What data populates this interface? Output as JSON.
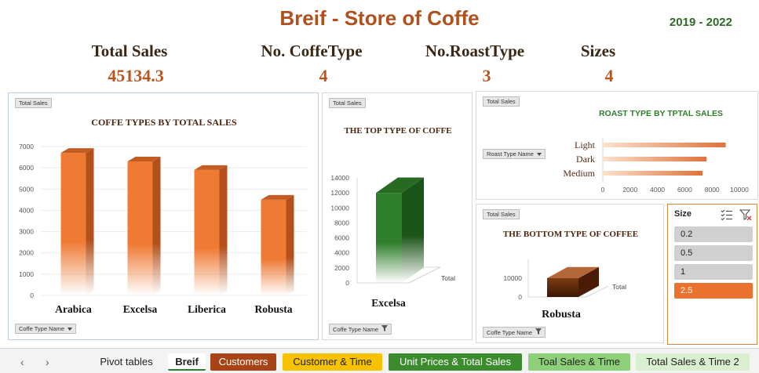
{
  "header": {
    "title": "Breif - Store of Coffe",
    "years": "2019 - 2022"
  },
  "kpis": [
    {
      "label": "Total Sales",
      "value": "45134.3"
    },
    {
      "label": "No. CoffeType",
      "value": "4"
    },
    {
      "label": "No.RoastType",
      "value": "3"
    },
    {
      "label": "Sizes",
      "value": "4"
    }
  ],
  "chips": {
    "total_sales": "Total Sales",
    "coffe_type_name": "Coffe Type Name",
    "roast_type_name": "Roast Type Name"
  },
  "colors": {
    "accent_orange": "#e8722e",
    "title_brown": "#b0501c",
    "green": "#2e6b25",
    "bar_green": "#2f7f2a",
    "bar_brown": "#6b3410"
  },
  "chart_data": [
    {
      "id": "coffe-types",
      "type": "bar",
      "title": "COFFE TYPES  BY  TOTAL SALES",
      "categories": [
        "Arabica",
        "Excelsa",
        "Liberica",
        "Robusta"
      ],
      "values": [
        6700,
        6300,
        5900,
        4500
      ],
      "yticks": [
        "0",
        "1000",
        "2000",
        "3000",
        "4000",
        "5000",
        "6000",
        "7000"
      ],
      "ylim": [
        0,
        7000
      ]
    },
    {
      "id": "top-type",
      "type": "bar",
      "title": "THE TOP TYPE OF COFFE",
      "categories": [
        "Excelsa"
      ],
      "values": [
        12000
      ],
      "yticks": [
        "0",
        "2000",
        "4000",
        "6000",
        "8000",
        "10000",
        "12000",
        "14000"
      ],
      "ylim": [
        0,
        14000
      ],
      "series_label": "Total"
    },
    {
      "id": "roast-type",
      "type": "bar",
      "title": "ROAST TYPE BY TPTAL SALES",
      "categories": [
        "Light",
        "Dark",
        "Medium"
      ],
      "values": [
        9000,
        7600,
        7300
      ],
      "xticks": [
        "0",
        "2000",
        "4000",
        "6000",
        "8000",
        "10000"
      ],
      "xlim": [
        0,
        10000
      ]
    },
    {
      "id": "bottom-type",
      "type": "bar",
      "title": "THE BOTTOM TYPE OF COFFEE",
      "categories": [
        "Robusta"
      ],
      "values": [
        10000
      ],
      "yticks": [
        "0",
        "10000"
      ],
      "ylim": [
        0,
        20000
      ],
      "series_label": "Total"
    }
  ],
  "slicer": {
    "title": "Size",
    "items": [
      "0.2",
      "0.5",
      "1",
      "2.5"
    ],
    "selected": "2.5"
  },
  "tabs": [
    {
      "label": "Pivot tables"
    },
    {
      "label": "Breif"
    },
    {
      "label": "Customers"
    },
    {
      "label": "Customer & Time"
    },
    {
      "label": "Unit Prices & Total Sales"
    },
    {
      "label": "Toal Sales & Time"
    },
    {
      "label": "Total Sales & Time 2"
    }
  ]
}
